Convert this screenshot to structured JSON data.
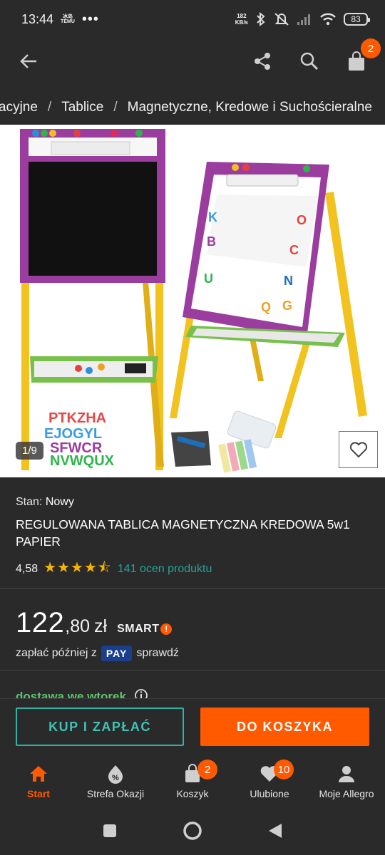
{
  "status_bar": {
    "time": "13:44",
    "logo_top": "冰岛",
    "logo_bottom": "TEMU",
    "more": "•••",
    "net_speed_value": "182",
    "net_speed_unit": "KB/s",
    "battery": "83"
  },
  "header": {
    "back_icon": "arrow-left-icon",
    "cart_badge": "2"
  },
  "breadcrumb": {
    "items": [
      "acyjne",
      "Tablice",
      "Magnetyczne, Kredowe i Suchościeralne"
    ],
    "separator": "/"
  },
  "gallery": {
    "counter": "1/9"
  },
  "product": {
    "condition_label": "Stan:",
    "condition_value": "Nowy",
    "title": "REGULOWANA TABLICA MAGNETYCZNA KREDOWA 5w1 PAPIER",
    "rating": "4,58",
    "stars": "★★★★⯪",
    "reviews": "141 ocen produktu",
    "price_main": "122",
    "price_dec": ",80",
    "currency": "zł",
    "smart_label": "SMART",
    "smart_mark": "!",
    "pay_later_prefix": "zapłać później z",
    "pay_badge": "PAY",
    "pay_later_suffix": "sprawdź",
    "delivery": "dostawa we wtorek"
  },
  "actions": {
    "buy_now": "KUP I ZAPŁAĆ",
    "add_to_cart": "DO KOSZYKA"
  },
  "bottom_nav": {
    "items": [
      {
        "label": "Start",
        "icon": "home-icon",
        "badge": ""
      },
      {
        "label": "Strefa Okazji",
        "icon": "deals-icon",
        "badge": ""
      },
      {
        "label": "Koszyk",
        "icon": "cart-icon",
        "badge": "2"
      },
      {
        "label": "Ulubione",
        "icon": "heart-icon",
        "badge": "10"
      },
      {
        "label": "Moje Allegro",
        "icon": "user-icon",
        "badge": ""
      }
    ]
  },
  "colors": {
    "accent": "#ff5a00",
    "teal": "#2fb1a6",
    "background": "#2a2a2a",
    "star": "#f6b400",
    "delivery": "#5dc26b"
  }
}
